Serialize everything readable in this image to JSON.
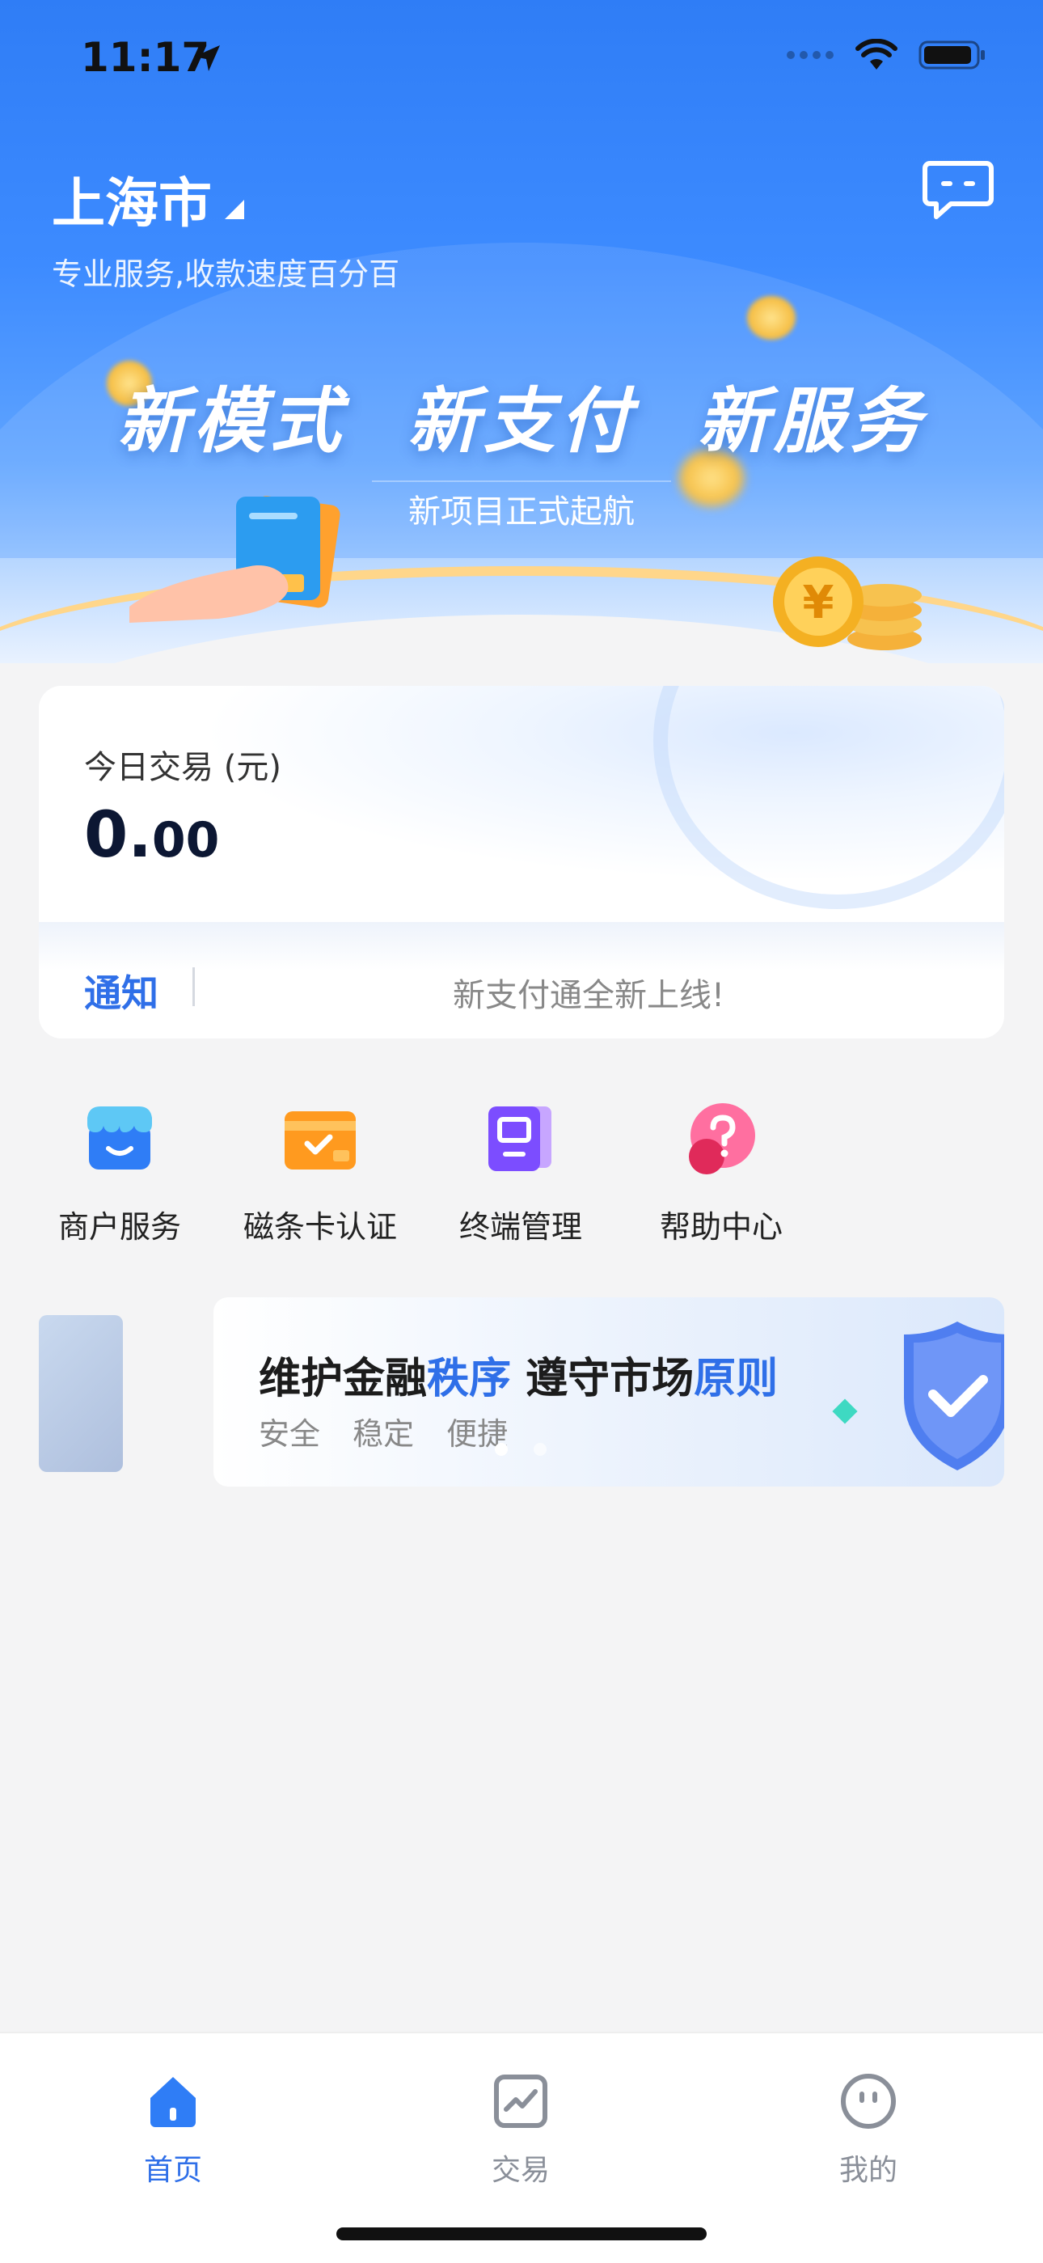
{
  "status_bar": {
    "time": "11:17"
  },
  "header": {
    "city": "上海市",
    "tagline": "专业服务,收款速度百分百",
    "message_icon": "message-icon"
  },
  "hero_banner": {
    "title": "新模式  新支付  新服务",
    "subtitle": "新项目正式起航"
  },
  "today_card": {
    "label": "今日交易 (元)",
    "amount_int": "0.",
    "amount_dec": "00",
    "notice_label": "通知",
    "notice_text": "新支付通全新上线!"
  },
  "quick_menu": [
    {
      "label": "商户服务",
      "icon": "store-icon"
    },
    {
      "label": "磁条卡认证",
      "icon": "card-check-icon"
    },
    {
      "label": "终端管理",
      "icon": "terminal-icon"
    },
    {
      "label": "帮助中心",
      "icon": "help-icon"
    }
  ],
  "promo": {
    "title_parts": [
      "维护金融",
      "秩序",
      " 遵守市场",
      "原则"
    ],
    "subtitle": "安全 稳定 便捷",
    "dots_total": 2,
    "dots_active": 1
  },
  "tabbar": {
    "tabs": [
      {
        "label": "首页",
        "icon": "home-icon",
        "active": true
      },
      {
        "label": "交易",
        "icon": "chart-icon",
        "active": false
      },
      {
        "label": "我的",
        "icon": "profile-icon",
        "active": false
      }
    ]
  },
  "colors": {
    "accent": "#2f6fe8",
    "hero_blue": "#3d8bff",
    "tab_inactive": "#8a8f99"
  }
}
